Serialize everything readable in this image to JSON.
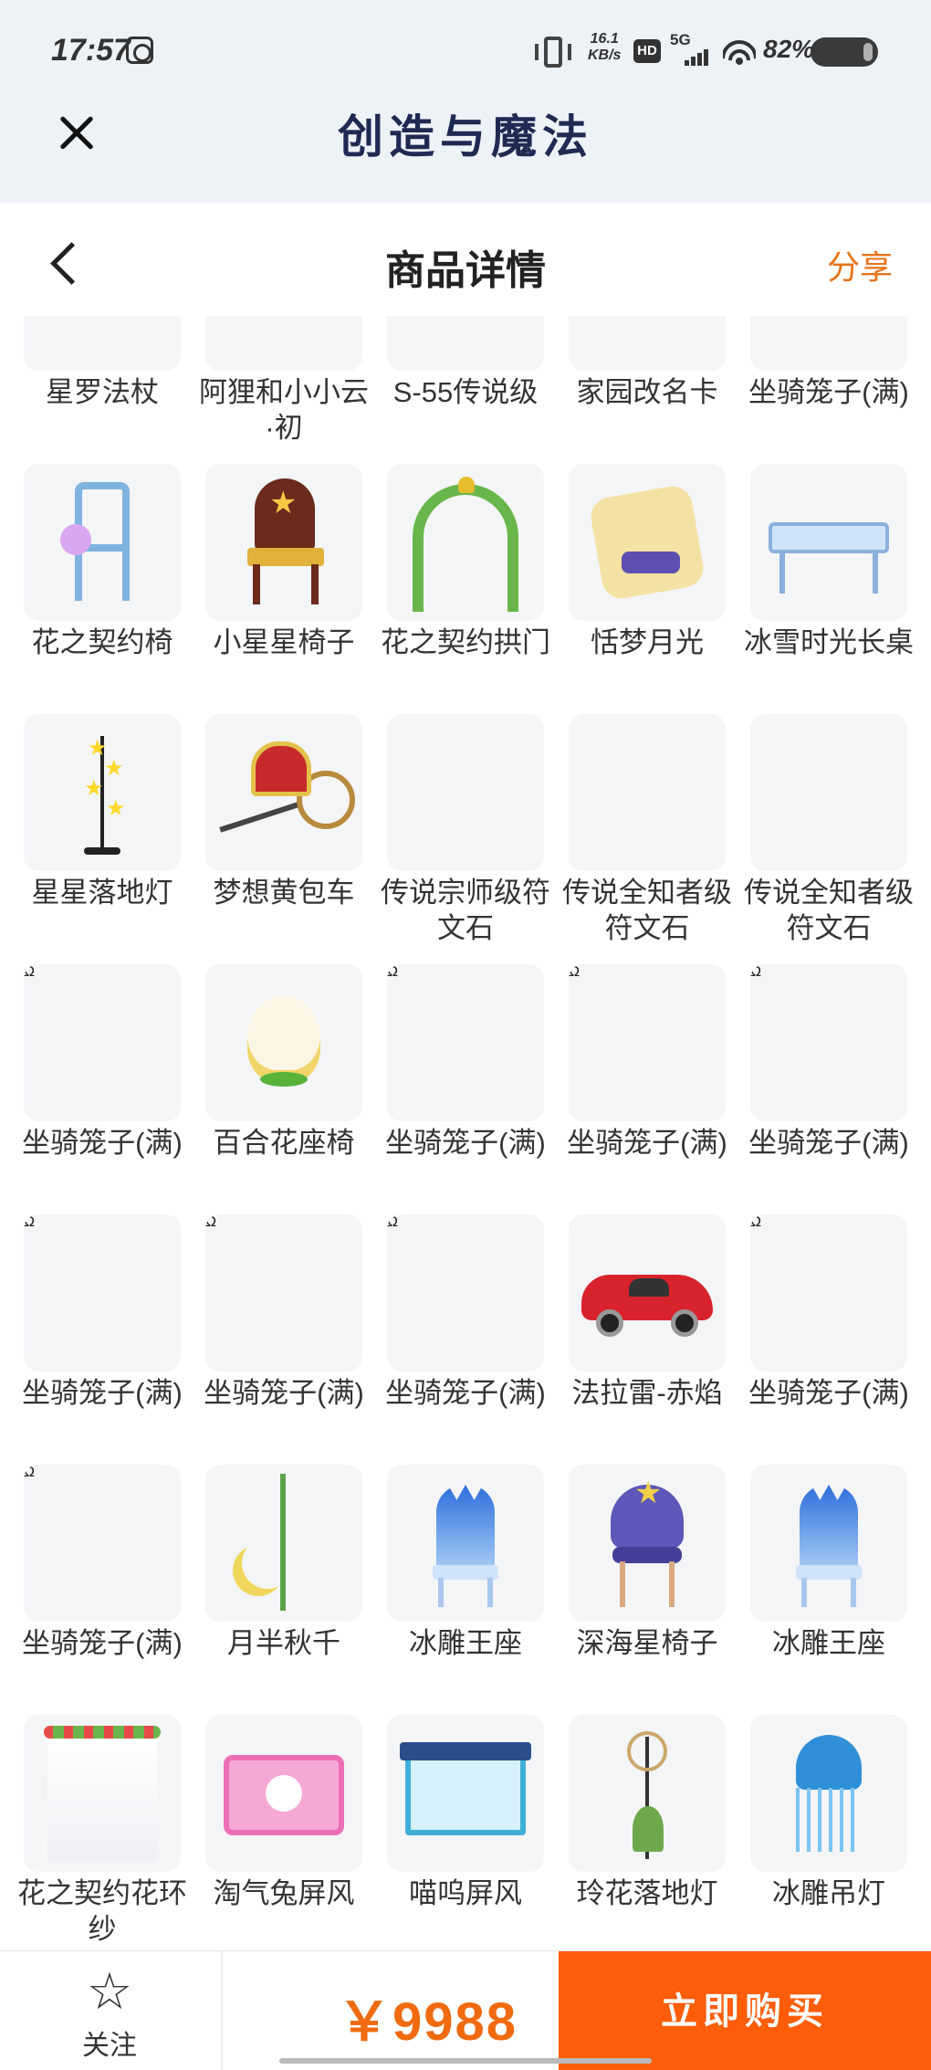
{
  "status_bar": {
    "time": "17:57",
    "speed_value": "16.1",
    "speed_unit": "KB/s",
    "hd": "HD",
    "network": "5G",
    "battery": "82%"
  },
  "app_header": {
    "title": "创造与魔法",
    "close_icon": "close-icon"
  },
  "page_header": {
    "title": "商品详情",
    "share_label": "分享",
    "back_icon": "chevron-left-icon"
  },
  "items": [
    {
      "name": "星罗法杖",
      "icon": "staff"
    },
    {
      "name": "阿狸和小小云·初",
      "icon": "mount"
    },
    {
      "name": "S-55传说级",
      "icon": "plane"
    },
    {
      "name": "家园改名卡",
      "icon": "card"
    },
    {
      "name": "坐骑笼子(满)",
      "icon": "cage"
    },
    {
      "name": "花之契约椅",
      "icon": "flower-chair"
    },
    {
      "name": "小星星椅子",
      "icon": "star-chair"
    },
    {
      "name": "花之契约拱门",
      "icon": "flower-arch"
    },
    {
      "name": "恬梦月光",
      "icon": "moon-bed"
    },
    {
      "name": "冰雪时光长桌",
      "icon": "ice-table"
    },
    {
      "name": "星星落地灯",
      "icon": "star-lamp"
    },
    {
      "name": "梦想黄包车",
      "icon": "rickshaw"
    },
    {
      "name": "传说宗师级符文石",
      "icon": "rune-orange"
    },
    {
      "name": "传说全知者级符文石",
      "icon": "rune-purple"
    },
    {
      "name": "传说全知者级符文石",
      "icon": "rune-purple"
    },
    {
      "name": "坐骑笼子(满)",
      "icon": "cage"
    },
    {
      "name": "百合花座椅",
      "icon": "lily-seat"
    },
    {
      "name": "坐骑笼子(满)",
      "icon": "cage"
    },
    {
      "name": "坐骑笼子(满)",
      "icon": "cage"
    },
    {
      "name": "坐骑笼子(满)",
      "icon": "cage"
    },
    {
      "name": "坐骑笼子(满)",
      "icon": "cage"
    },
    {
      "name": "坐骑笼子(满)",
      "icon": "cage"
    },
    {
      "name": "坐骑笼子(满)",
      "icon": "cage"
    },
    {
      "name": "法拉雷-赤焰",
      "icon": "red-car"
    },
    {
      "name": "坐骑笼子(满)",
      "icon": "cage"
    },
    {
      "name": "坐骑笼子(满)",
      "icon": "cage"
    },
    {
      "name": "月半秋千",
      "icon": "moon-swing"
    },
    {
      "name": "冰雕王座",
      "icon": "ice-throne"
    },
    {
      "name": "深海星椅子",
      "icon": "sea-star-chair"
    },
    {
      "name": "冰雕王座",
      "icon": "ice-throne"
    },
    {
      "name": "花之契约花环纱",
      "icon": "flower-veil"
    },
    {
      "name": "淘气兔屏风",
      "icon": "bunny-screen"
    },
    {
      "name": "喵呜屏风",
      "icon": "cat-screen"
    },
    {
      "name": "玲花落地灯",
      "icon": "floor-lamp"
    },
    {
      "name": "冰雕吊灯",
      "icon": "ice-chandelier"
    },
    {
      "name": "",
      "icon": "partial"
    },
    {
      "name": "",
      "icon": "partial"
    },
    {
      "name": "",
      "icon": "partial"
    },
    {
      "name": "",
      "icon": "partial"
    },
    {
      "name": "",
      "icon": "partial"
    }
  ],
  "bottom_bar": {
    "favorite_label": "关注",
    "favorite_icon": "star-outline-icon",
    "price": "￥9988",
    "buy_label": "立即购买"
  },
  "colors": {
    "accent_orange": "#ff5d0a",
    "price_orange": "#f06a0f",
    "share_orange": "#e8731a",
    "header_bg": "#edf2f7",
    "title_navy": "#1e2a52"
  }
}
